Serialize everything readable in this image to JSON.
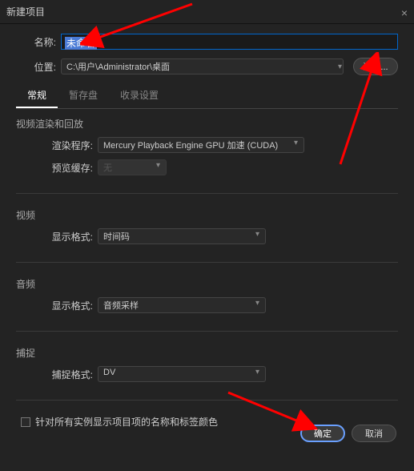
{
  "dialog": {
    "title": "新建项目"
  },
  "form": {
    "name_label": "名称:",
    "name_value": "未命名",
    "location_label": "位置:",
    "location_value": "C:\\用户\\Administrator\\桌面",
    "browse_label": "浏览..."
  },
  "tabs": {
    "general": "常规",
    "scratch": "暂存盘",
    "ingest": "收录设置"
  },
  "sections": {
    "render": {
      "title": "视频渲染和回放",
      "renderer_label": "渲染程序:",
      "renderer_value": "Mercury Playback Engine GPU 加速 (CUDA)",
      "preview_label": "预览缓存:",
      "preview_value": "无"
    },
    "video": {
      "title": "视频",
      "format_label": "显示格式:",
      "format_value": "时间码"
    },
    "audio": {
      "title": "音频",
      "format_label": "显示格式:",
      "format_value": "音频采样"
    },
    "capture": {
      "title": "捕捉",
      "format_label": "捕捉格式:",
      "format_value": "DV"
    }
  },
  "checkbox": {
    "label": "针对所有实例显示项目项的名称和标签颜色"
  },
  "footer": {
    "ok": "确定",
    "cancel": "取消"
  }
}
